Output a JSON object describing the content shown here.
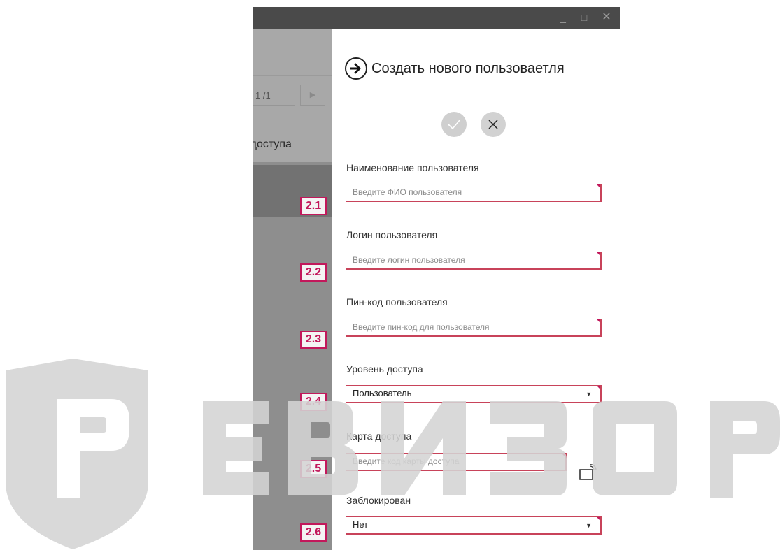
{
  "window": {
    "min_glyph": "_",
    "max_glyph": "□",
    "close_glyph": "✕"
  },
  "background_app": {
    "pager_text": "1 /1",
    "column_header": "нь доступа"
  },
  "form": {
    "title": "Создать нового пользоваетля",
    "fields": [
      {
        "label": "Наименование пользователя",
        "placeholder": "Введите ФИО пользователя",
        "badge": "2.1"
      },
      {
        "label": "Логин пользователя",
        "placeholder": "Введите логин пользователя",
        "badge": "2.2"
      },
      {
        "label": "Пин-код пользователя",
        "placeholder": "Введите пин-код для пользователя",
        "badge": "2.3"
      },
      {
        "label": "Уровень доступа",
        "value": "Пользователь",
        "badge": "2.4"
      },
      {
        "label": "Карта доступа",
        "placeholder": "Введите код карты доступа",
        "badge": "2.5"
      },
      {
        "label": "Заблокирован",
        "value": "Нет",
        "badge": "2.6"
      }
    ]
  },
  "watermark": {
    "logo_text": "РЕВИЗОР",
    "color": "#d4d4d4"
  },
  "colors": {
    "accent": "#c2185b",
    "titlebar": "#4a4a4a",
    "overlay": "#8e8e8e"
  }
}
